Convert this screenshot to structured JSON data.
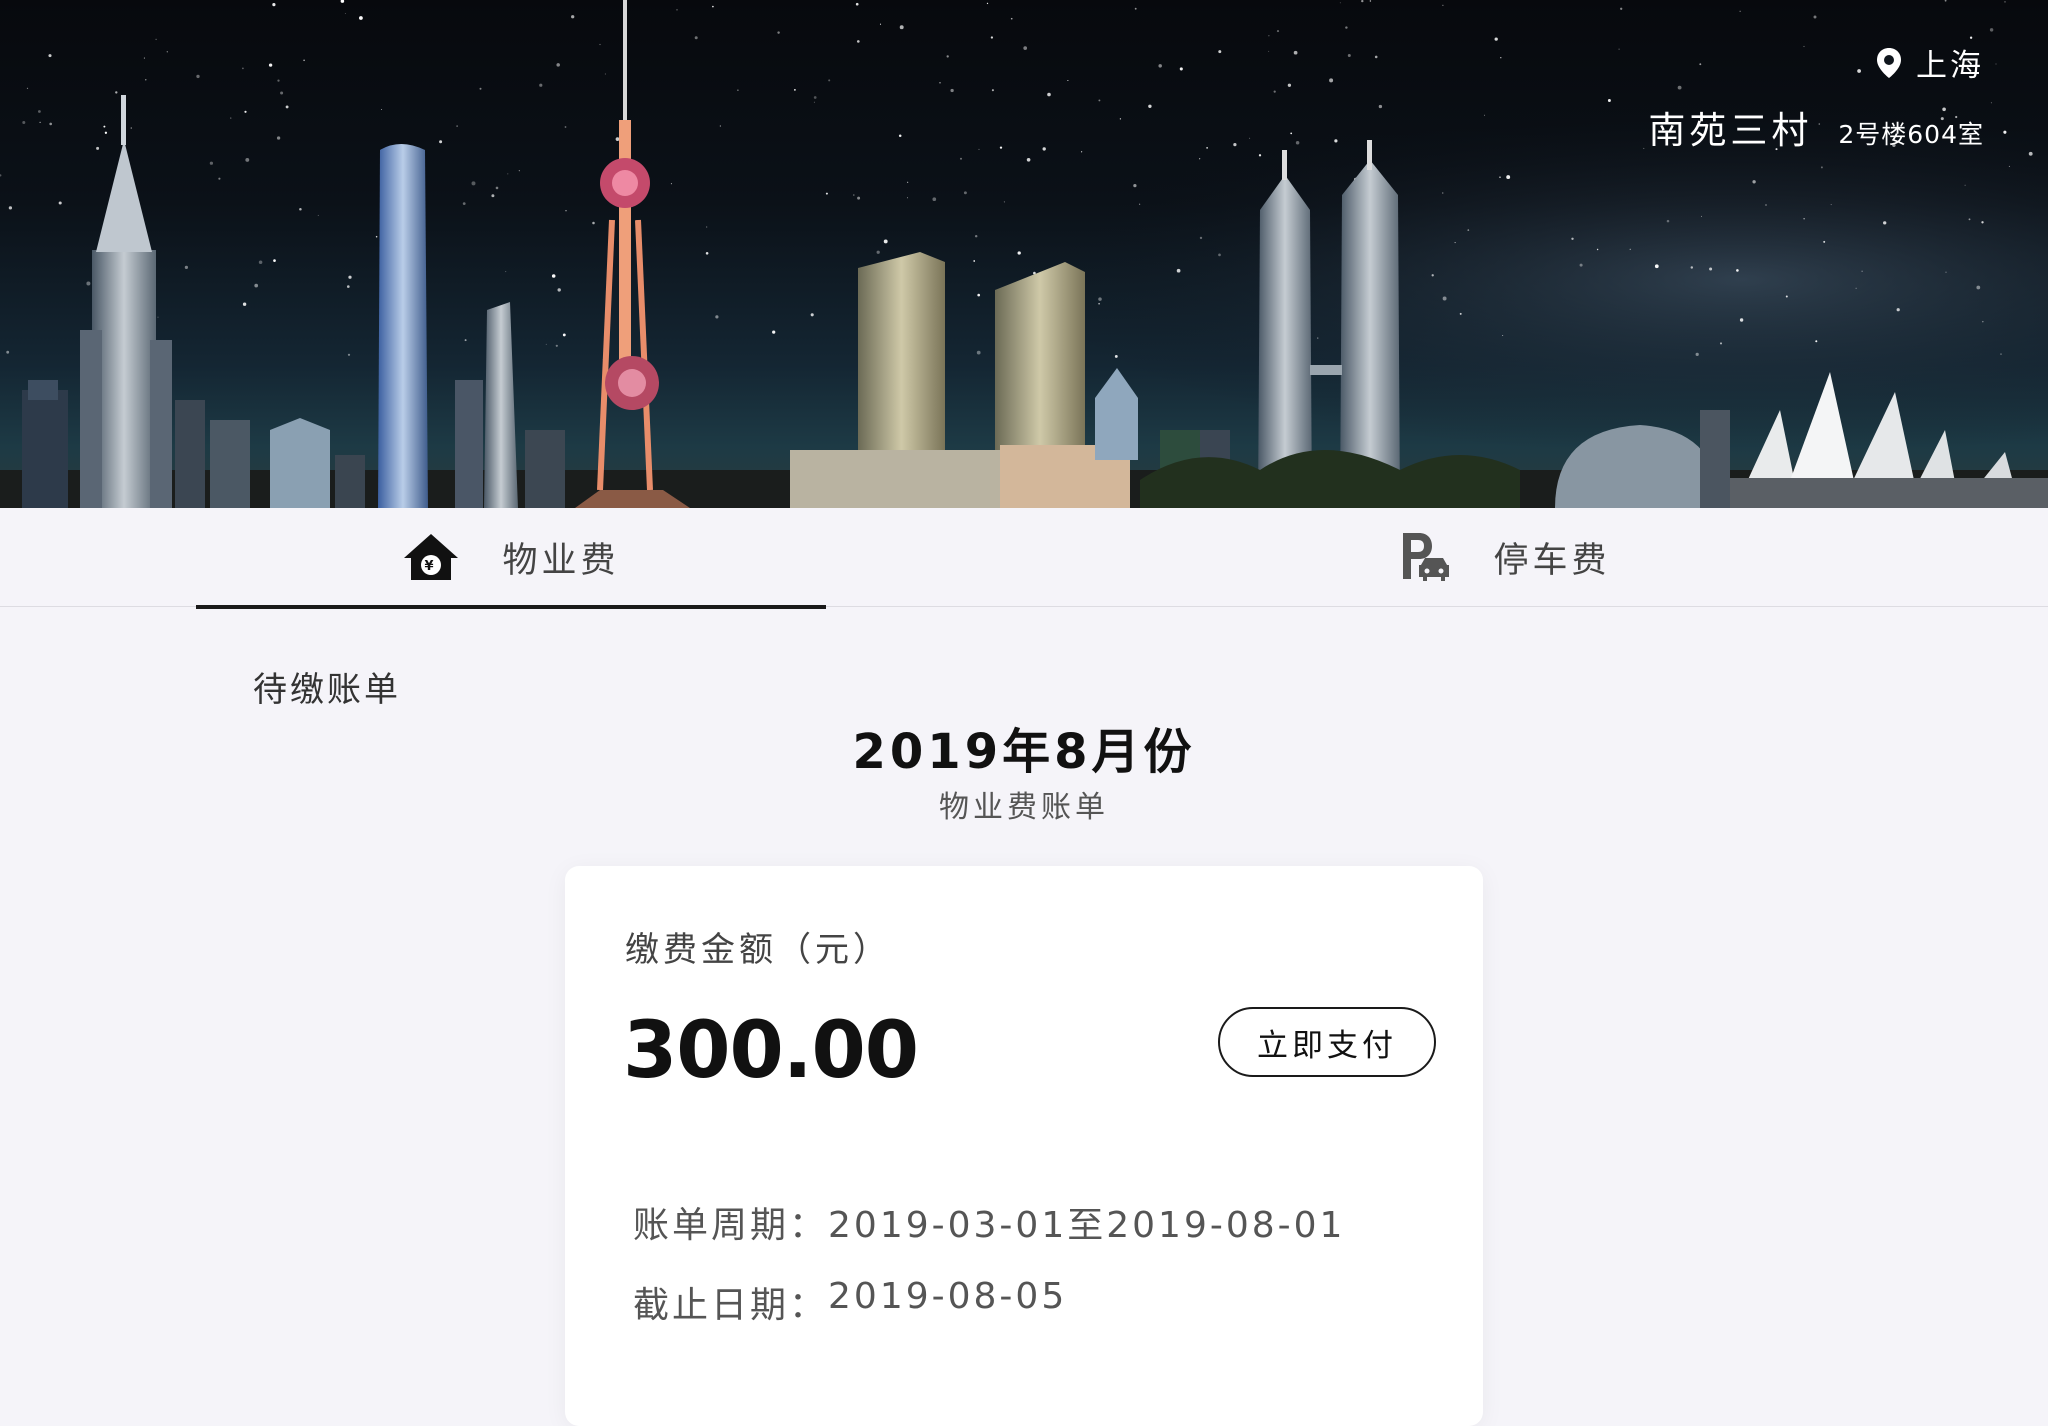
{
  "header": {
    "city": "上海",
    "community": "南苑三村",
    "unit": "2号楼604室"
  },
  "tabs": [
    {
      "label": "物业费",
      "icon": "house-yuan-icon",
      "active": true
    },
    {
      "label": "停车费",
      "icon": "parking-car-icon",
      "active": false
    }
  ],
  "main": {
    "section_title": "待缴账单",
    "month": "2019年8月份",
    "bill_type": "物业费账单"
  },
  "card": {
    "amount_label": "缴费金额（元）",
    "amount": "300.00",
    "pay_button": "立即支付",
    "period_label": "账单周期：",
    "period_value": "2019-03-01至2019-08-01",
    "deadline_label": "截止日期：",
    "deadline_value": "2019-08-05"
  },
  "colors": {
    "page_bg": "#f5f4f9",
    "card_bg": "#ffffff",
    "text_primary": "#111111",
    "tab_underline": "#1a1a1a"
  }
}
